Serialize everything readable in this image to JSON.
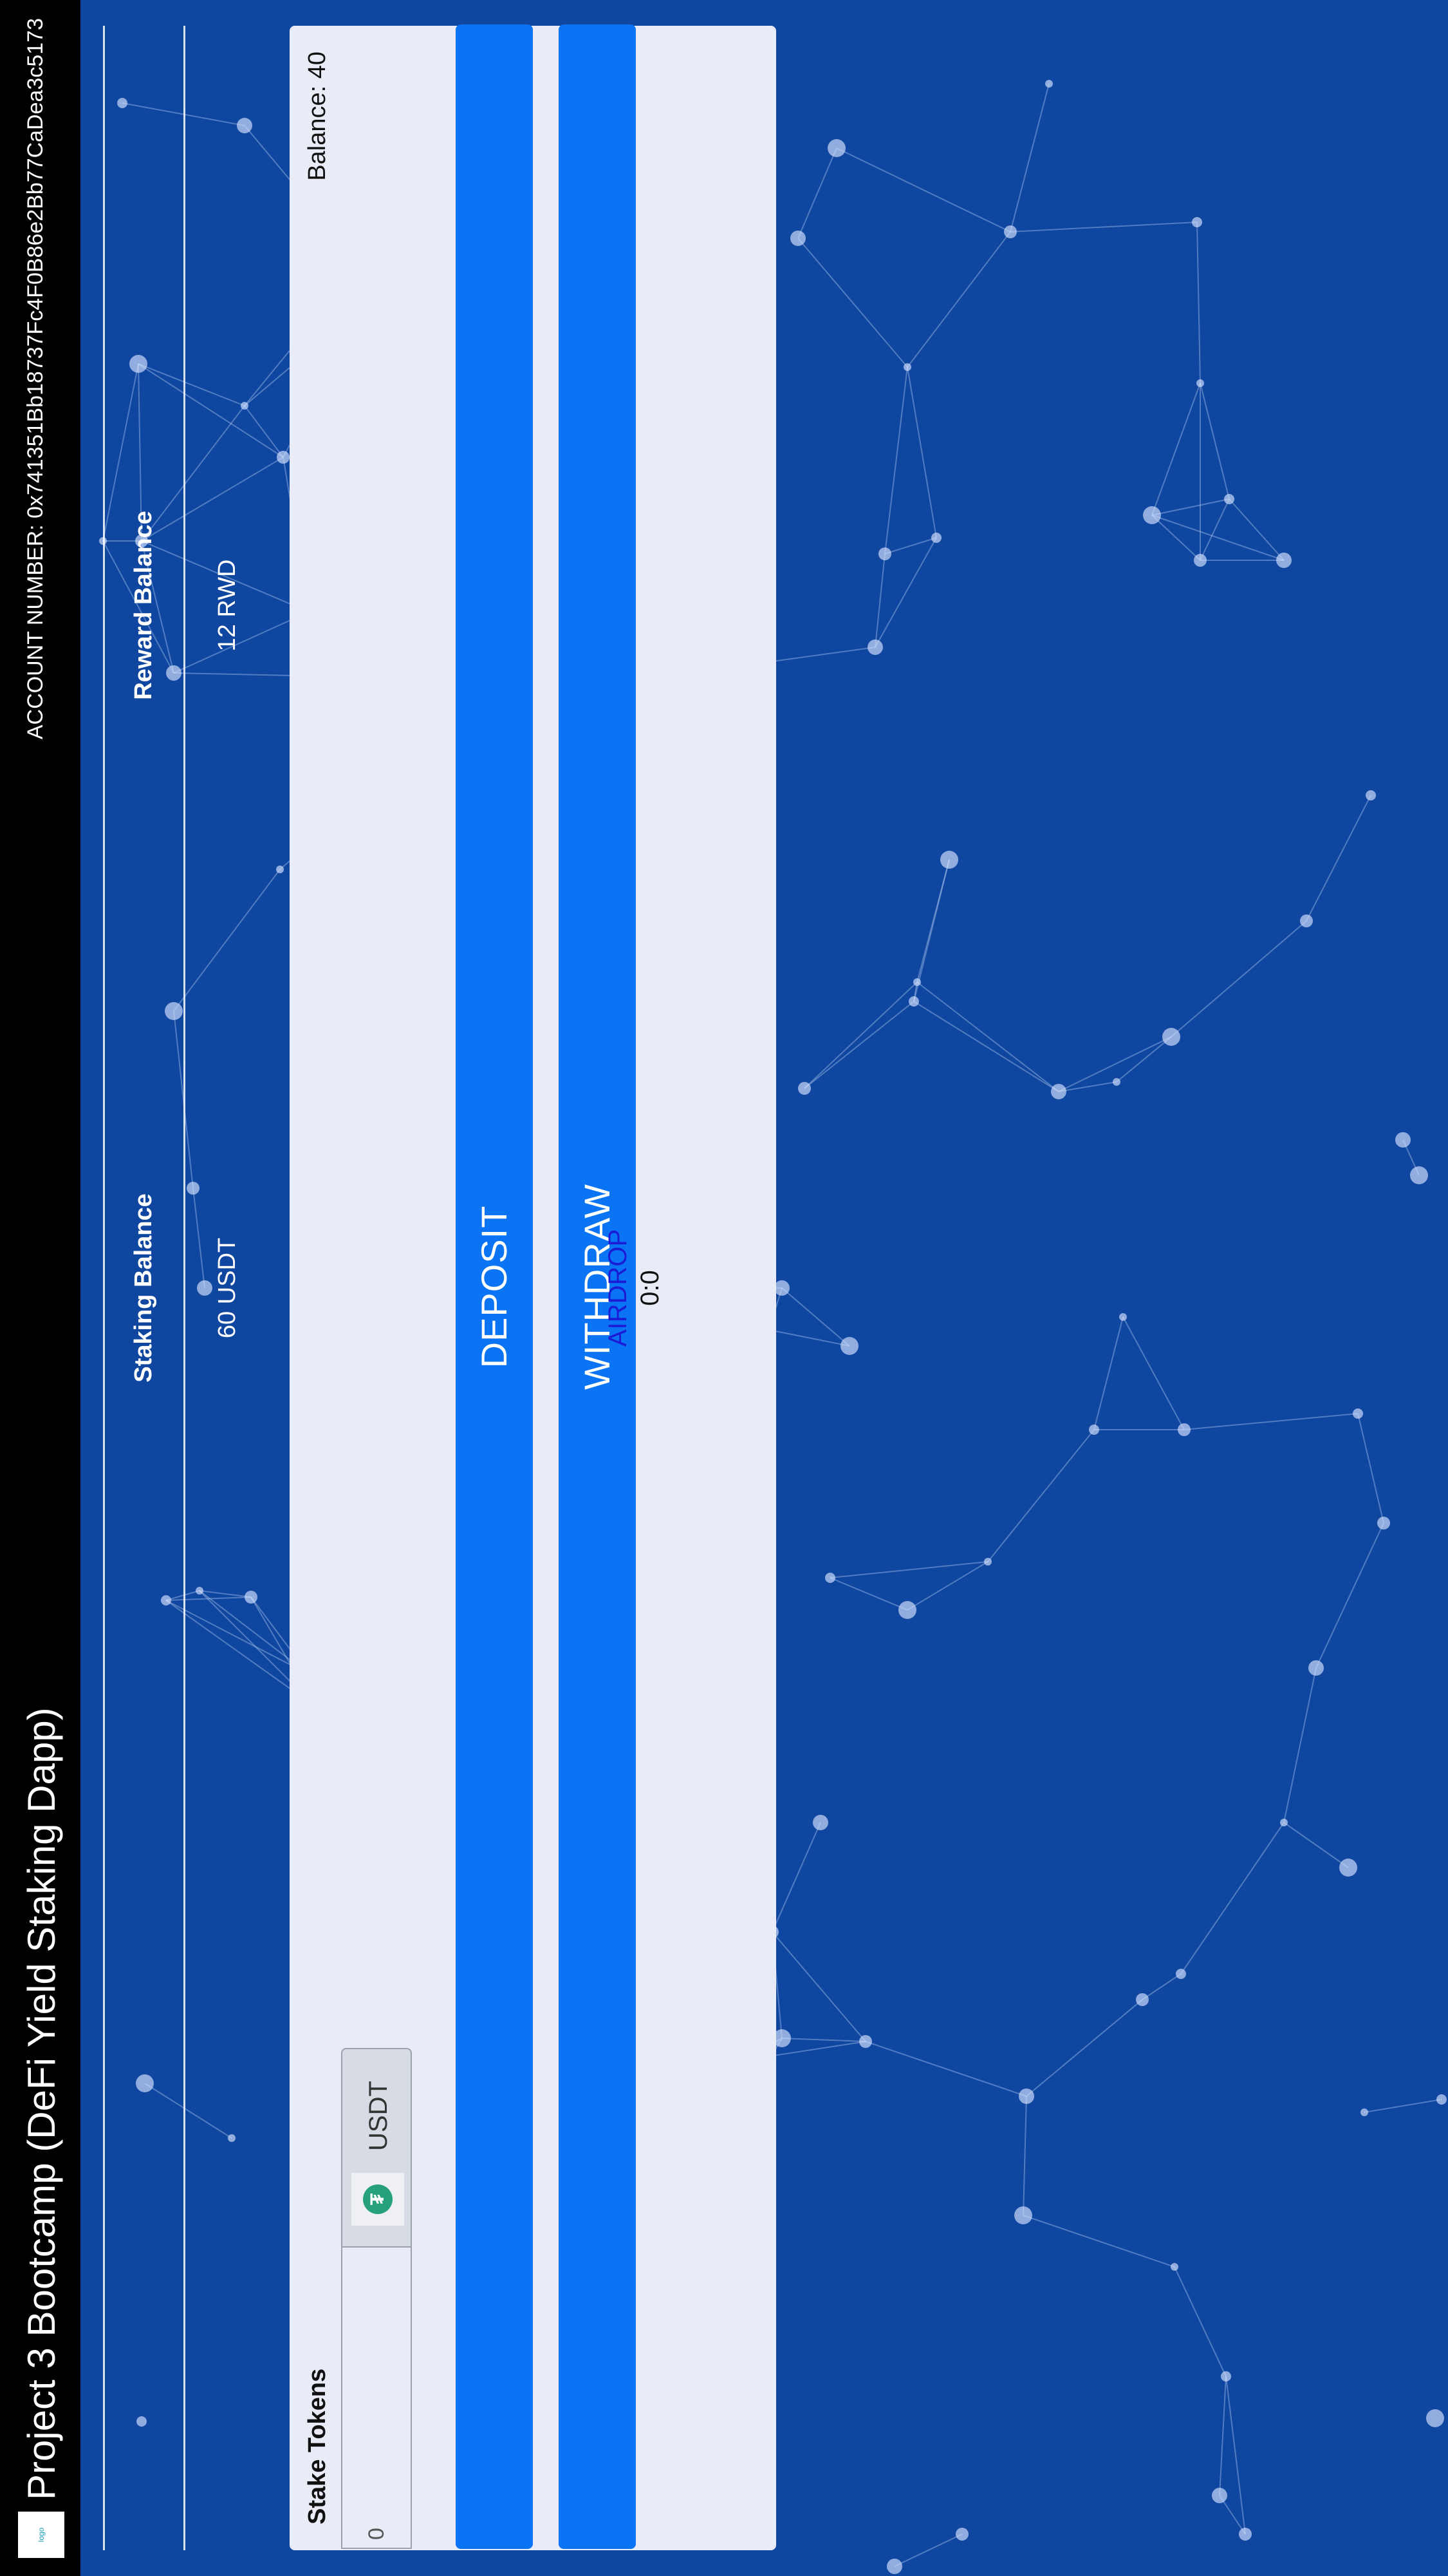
{
  "navbar": {
    "brand_icon": "dapp-logo",
    "title": "Project 3 Bootcamp (DeFi Yield Staking Dapp)",
    "account": "ACCOUNT NUMBER: 0x741351Bb18737Fc4F0B86e2Bb77CaDea3c5173"
  },
  "balances": {
    "staking_header": "Staking Balance",
    "reward_header": "Reward Balance",
    "staking_value": "60 USDT",
    "reward_value": "12 RWD"
  },
  "stake": {
    "label": "Stake Tokens",
    "balance": "Balance: 40",
    "amount_value": "0",
    "token_icon": "tether-icon",
    "token": "USDT",
    "deposit_label": "DEPOSIT",
    "withdraw_label": "WITHDRAW",
    "airdrop_label": "AIRDROP",
    "airdrop_timer": "0:0"
  },
  "colors": {
    "background": "#0f46a0",
    "navbar": "#000000",
    "card": "#e9ecf6",
    "button": "#0a74f5",
    "airdrop_link": "#1b1bd6",
    "usdt": "#26a17b"
  }
}
